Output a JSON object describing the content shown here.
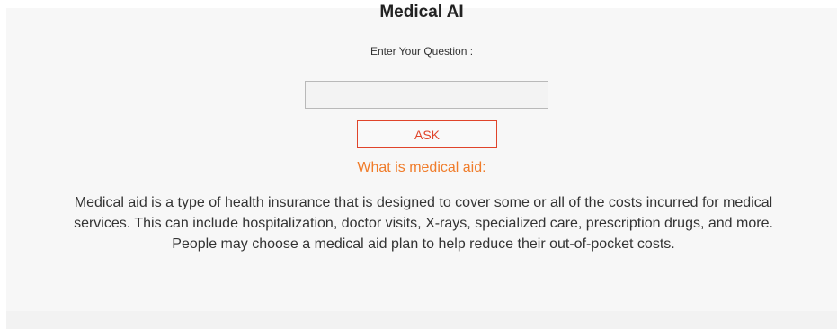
{
  "app": {
    "title": "Medical AI"
  },
  "form": {
    "prompt_label": "Enter Your Question :",
    "question_value": "",
    "question_placeholder": "",
    "ask_label": "ASK"
  },
  "answer": {
    "heading": "What is medical aid:",
    "text": "Medical aid is a type of health insurance that is designed to cover some or all of the costs incurred for medical services. This can include hospitalization, doctor visits, X-rays, specialized care, prescription drugs, and more. People may choose a medical aid plan to help reduce their out-of-pocket costs."
  },
  "colors": {
    "accent_orange": "#f07c2a",
    "button_red": "#e0442a",
    "panel_background": "#f7f7f7"
  }
}
